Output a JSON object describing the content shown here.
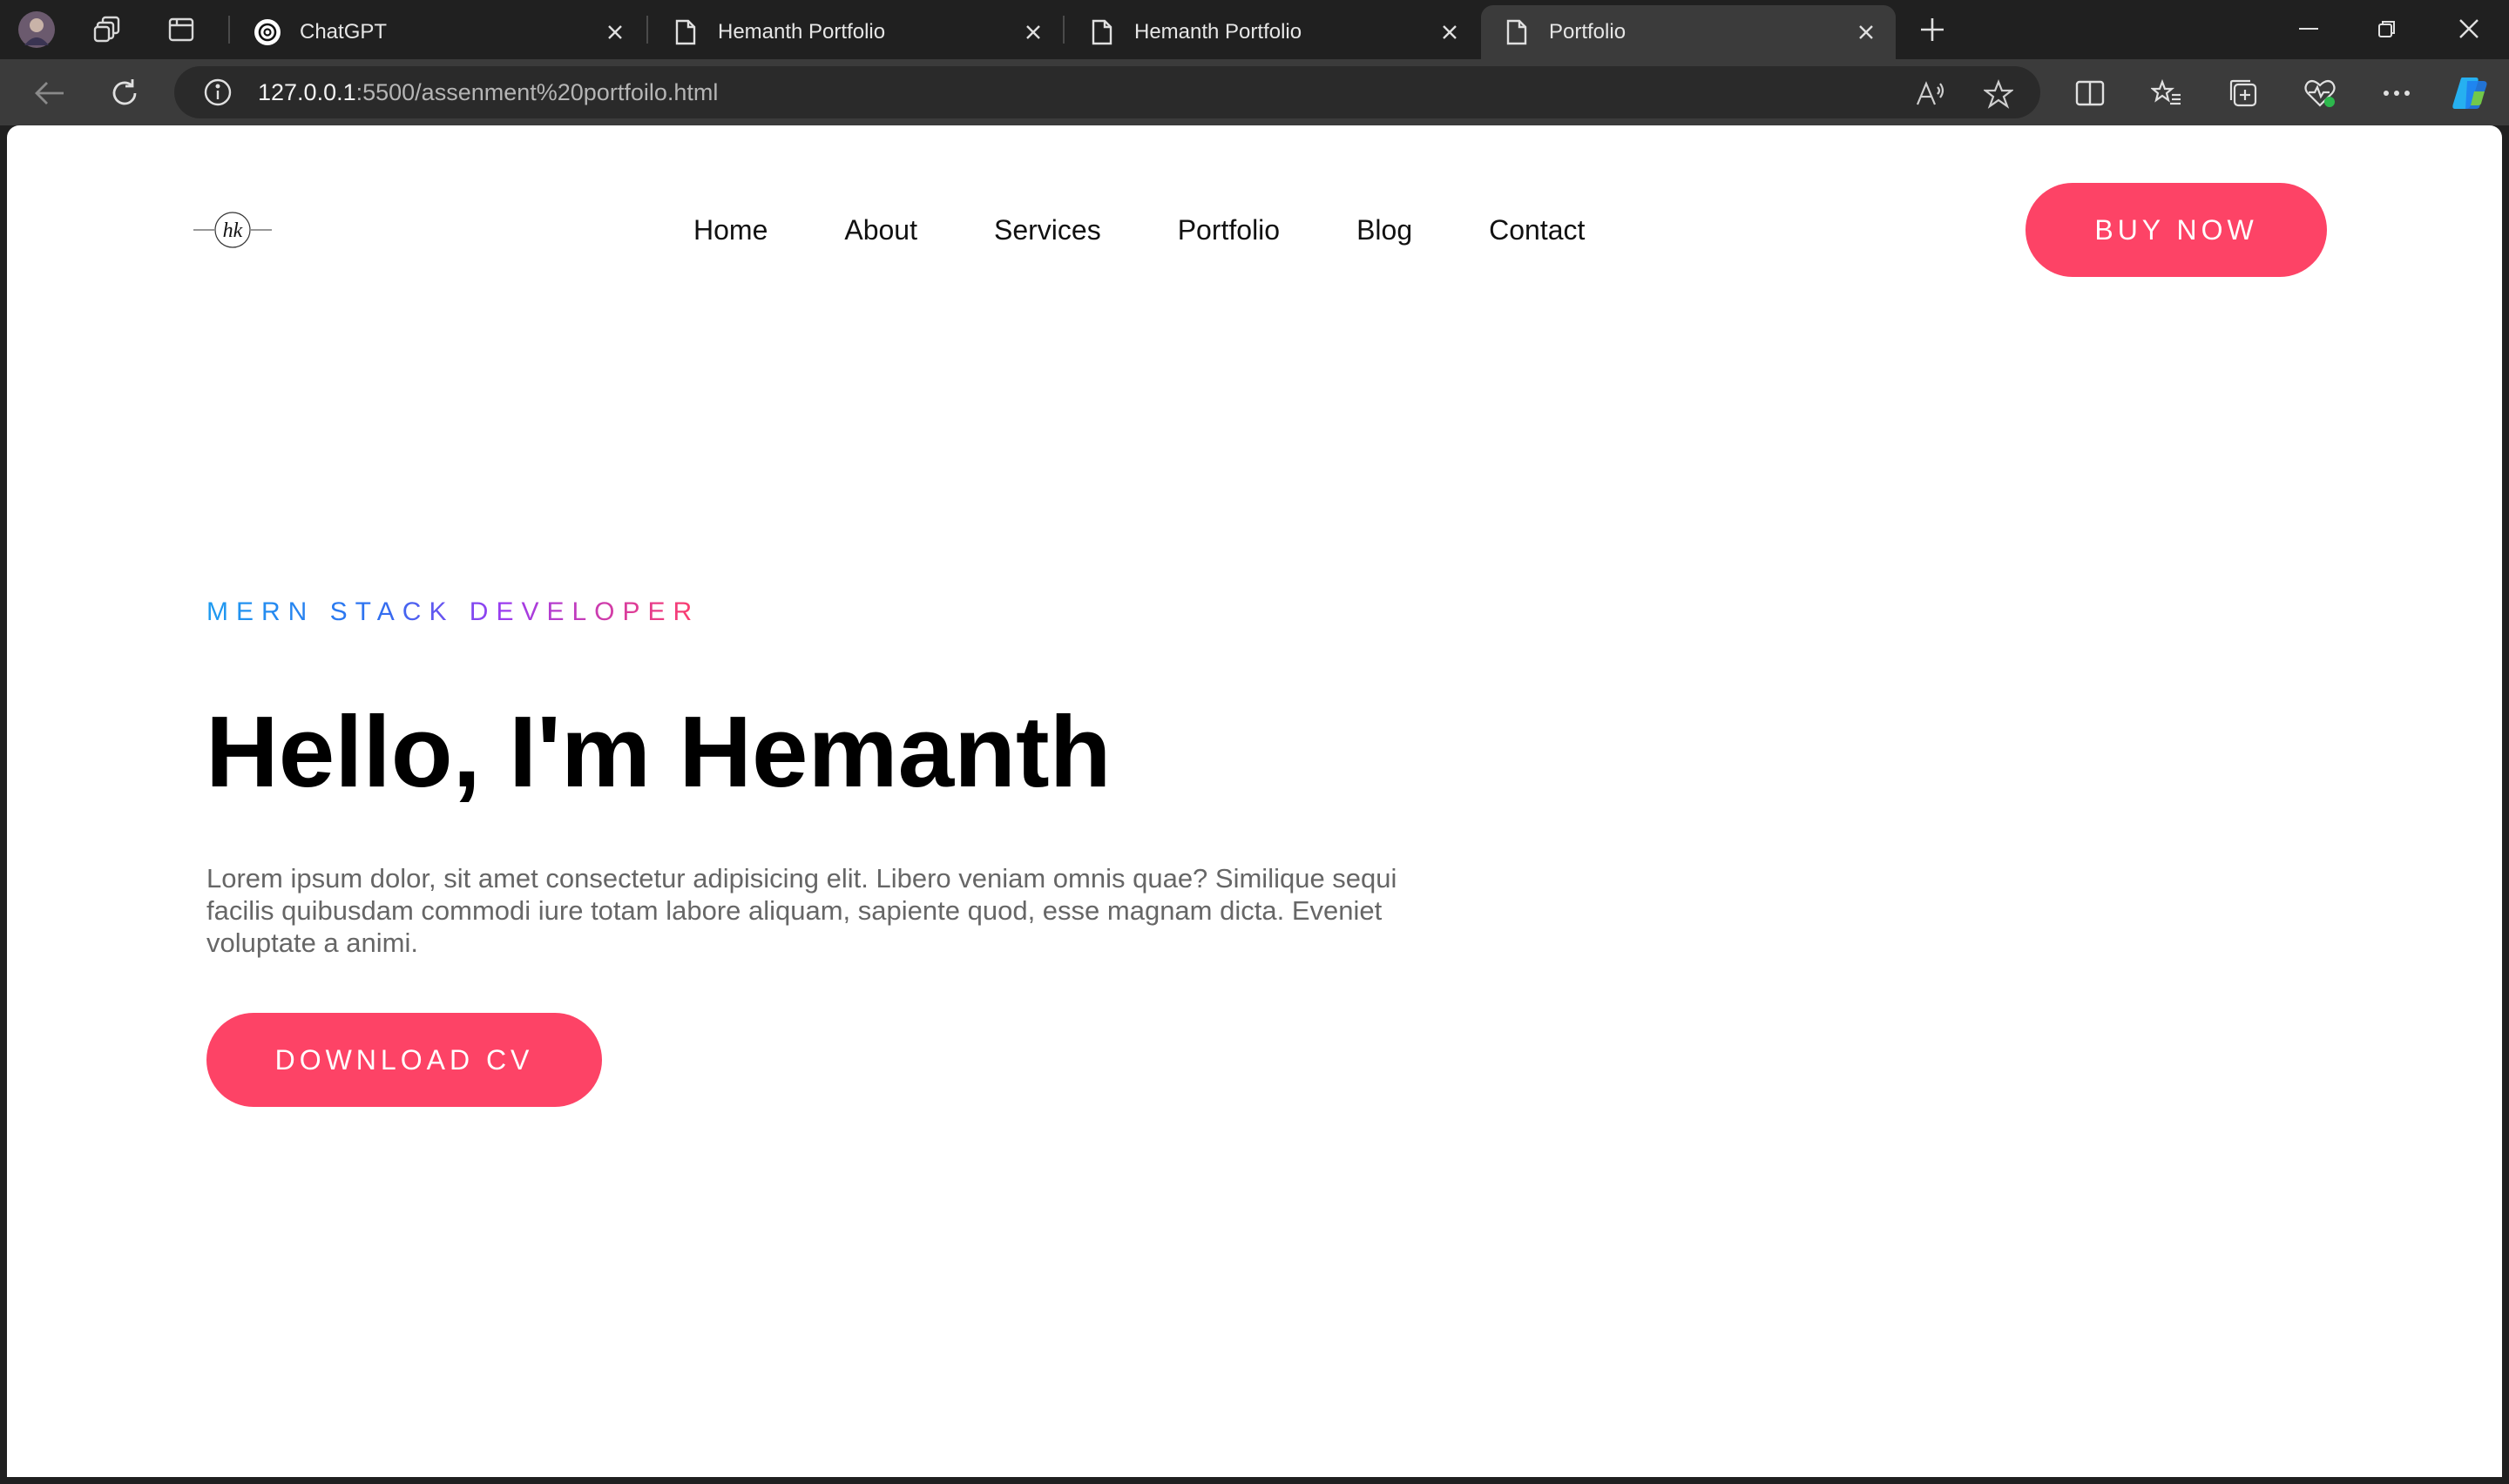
{
  "browser": {
    "tabs": [
      {
        "title": "ChatGPT",
        "favicon": "chatgpt-icon",
        "active": false
      },
      {
        "title": "Hemanth Portfolio",
        "favicon": "page-icon",
        "active": false
      },
      {
        "title": "Hemanth Portfolio",
        "favicon": "page-icon",
        "active": false
      },
      {
        "title": "Portfolio",
        "favicon": "page-icon",
        "active": true
      }
    ],
    "url_host": "127.0.0.1",
    "url_rest": ":5500/assenment%20portfoilo.html",
    "colors": {
      "titlebar": "#202020",
      "toolbar": "#3b3b3b",
      "omnibox": "#2a2a2a"
    }
  },
  "page": {
    "logo_text": "hk",
    "nav": [
      "Home",
      "About",
      "Services",
      "Portfolio",
      "Blog",
      "Contact"
    ],
    "buy_label": "BUY NOW",
    "role": "MERN STACK DEVELOPER",
    "heading": "Hello, I'm Hemanth",
    "intro": "Lorem ipsum dolor, sit amet consectetur adipisicing elit. Libero veniam omnis quae? Similique sequi facilis quibusdam commodi iure totam labore aliquam, sapiente quod, esse magnam dicta. Eveniet voluptate a animi.",
    "cta_label": "DOWNLOAD CV",
    "colors": {
      "accent": "#fd4366",
      "background": "#ffffff",
      "text": "#000000",
      "muted": "#666666"
    }
  }
}
